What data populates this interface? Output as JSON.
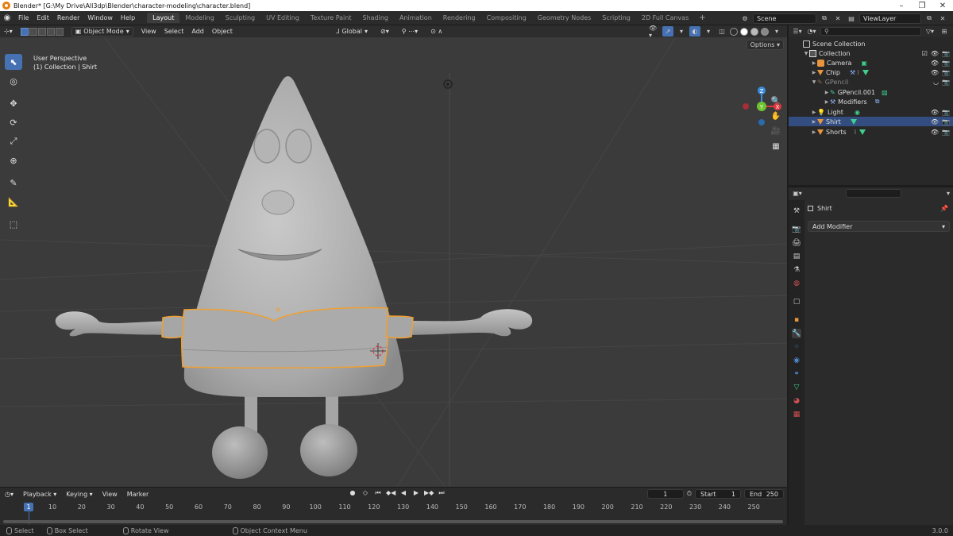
{
  "window": {
    "title": "Blender* [G:\\My Drive\\All3dp\\Blender\\character-modeling\\character.blend]"
  },
  "menu": [
    "File",
    "Edit",
    "Render",
    "Window",
    "Help"
  ],
  "workspaces": [
    "Layout",
    "Modeling",
    "Sculpting",
    "UV Editing",
    "Texture Paint",
    "Shading",
    "Animation",
    "Rendering",
    "Compositing",
    "Geometry Nodes",
    "Scripting",
    "2D Full Canvas"
  ],
  "active_workspace": "Layout",
  "scene_name": "Scene",
  "view_layer": "ViewLayer",
  "viewport": {
    "mode": "Object Mode",
    "menu": [
      "View",
      "Select",
      "Add",
      "Object"
    ],
    "orientation": "Global",
    "options_label": "Options",
    "info_line1": "User Perspective",
    "info_line2": "(1) Collection | Shirt",
    "gizmo_labels": {
      "z": "Z",
      "y": "Y",
      "x": "X"
    }
  },
  "outliner": {
    "rows": [
      {
        "label": "Scene Collection"
      },
      {
        "label": "Collection"
      },
      {
        "label": "Camera"
      },
      {
        "label": "Chip"
      },
      {
        "label": "GPencil"
      },
      {
        "label": "GPencil.001"
      },
      {
        "label": "Modifiers"
      },
      {
        "label": "Light"
      },
      {
        "label": "Shirt"
      },
      {
        "label": "Shorts"
      }
    ]
  },
  "properties": {
    "object_name": "Shirt",
    "add_modifier": "Add Modifier"
  },
  "timeline": {
    "menu": [
      "Playback",
      "Keying",
      "View",
      "Marker"
    ],
    "current_frame": "1",
    "start_label": "Start",
    "start_value": "1",
    "end_label": "End",
    "end_value": "250",
    "cursor_label": "1",
    "ticks": [
      "10",
      "20",
      "30",
      "40",
      "50",
      "60",
      "70",
      "80",
      "90",
      "100",
      "110",
      "120",
      "130",
      "140",
      "150",
      "160",
      "170",
      "180",
      "190",
      "200",
      "210",
      "220",
      "230",
      "240",
      "250"
    ]
  },
  "status": {
    "select": "Select",
    "box_select": "Box Select",
    "rotate_view": "Rotate View",
    "context_menu": "Object Context Menu",
    "version": "3.0.0"
  },
  "colors": {
    "accent": "#4672b4",
    "selection_outline": "#f0a030",
    "mesh_orange": "#e8953d",
    "mesh_green": "#3fcf8e",
    "axis_x": "#e0383e",
    "axis_y": "#6ec530",
    "axis_z": "#3b8ee0"
  }
}
